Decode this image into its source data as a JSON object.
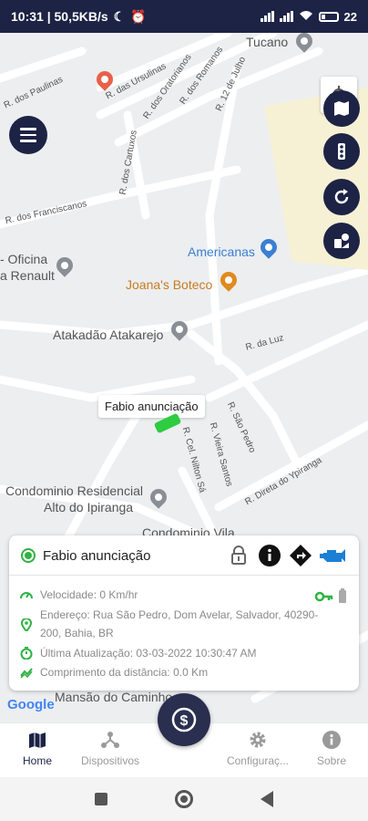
{
  "status_bar": {
    "time_network": "10:31 | 50,5KB/s",
    "battery": "22"
  },
  "map": {
    "streets": [
      "R. dos Paulinas",
      "R. das Ursulinas",
      "R. dos Oratorianos",
      "R. dos Romanos",
      "R. 12 de Julho",
      "R. dos Cartuxos",
      "R. dos Franciscanos",
      "R. da Luz",
      "R. São Pedro",
      "R. Vieira Santos",
      "R. Cel. Nilton Sá",
      "R. Direta do Ypiranga"
    ],
    "places": {
      "tucano": "Tucano",
      "americanas": "Americanas",
      "joanas": "Joana's Boteco",
      "oficina_line1": "- Oficina",
      "oficina_line2": "a Renault",
      "atakadao": "Atakadão Atakarejo",
      "condominio_line1": "Condominio Residencial",
      "condominio_line2": "Alto do Ipiranga",
      "condominio_vila": "Condominio Vila",
      "mansao": "Mansão do Caminho"
    },
    "marker_label": "Fabio anunciação",
    "google_logo": "Google"
  },
  "card": {
    "title": "Fabio anunciação",
    "speed": "Velocidade: 0 Km/hr",
    "address": "Endereço: Rua São Pedro, Dom Avelar, Salvador, 40290-200, Bahia, BR",
    "last_update": "Última Atualização: 03-03-2022 10:30:47 AM",
    "distance": "Comprimento da distância: 0.0 Km"
  },
  "nav": {
    "items": [
      {
        "label": "Home"
      },
      {
        "label": "Dispositivos"
      },
      {
        "label": "Configuraç..."
      },
      {
        "label": "Sobre"
      }
    ],
    "fab_symbol": "$"
  },
  "colors": {
    "primary": "#1d2345",
    "online": "#2fb344",
    "map_bg": "#eceef0"
  }
}
